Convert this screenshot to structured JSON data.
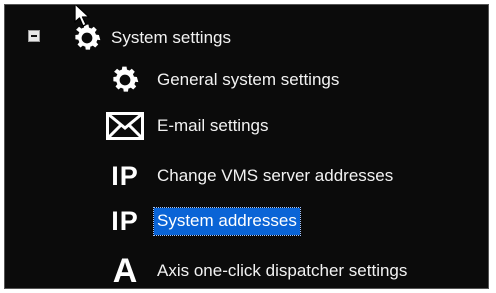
{
  "tree": {
    "root": {
      "label": "System settings",
      "expanded": true,
      "icon": "gear-icon"
    },
    "children": [
      {
        "label": "General system settings",
        "icon": "gear-icon",
        "selected": false
      },
      {
        "label": "E-mail settings",
        "icon": "envelope-icon",
        "selected": false
      },
      {
        "label": "Change VMS server addresses",
        "icon": "ip-icon",
        "icon_text": "IP",
        "selected": false
      },
      {
        "label": "System addresses",
        "icon": "ip-icon",
        "icon_text": "IP",
        "selected": true
      },
      {
        "label": "Axis one-click dispatcher settings",
        "icon": "axis-icon",
        "icon_text": "A",
        "selected": false
      }
    ]
  },
  "colors": {
    "background": "#0b0b0b",
    "text": "#f2f2f2",
    "selection": "#0a64d6"
  }
}
